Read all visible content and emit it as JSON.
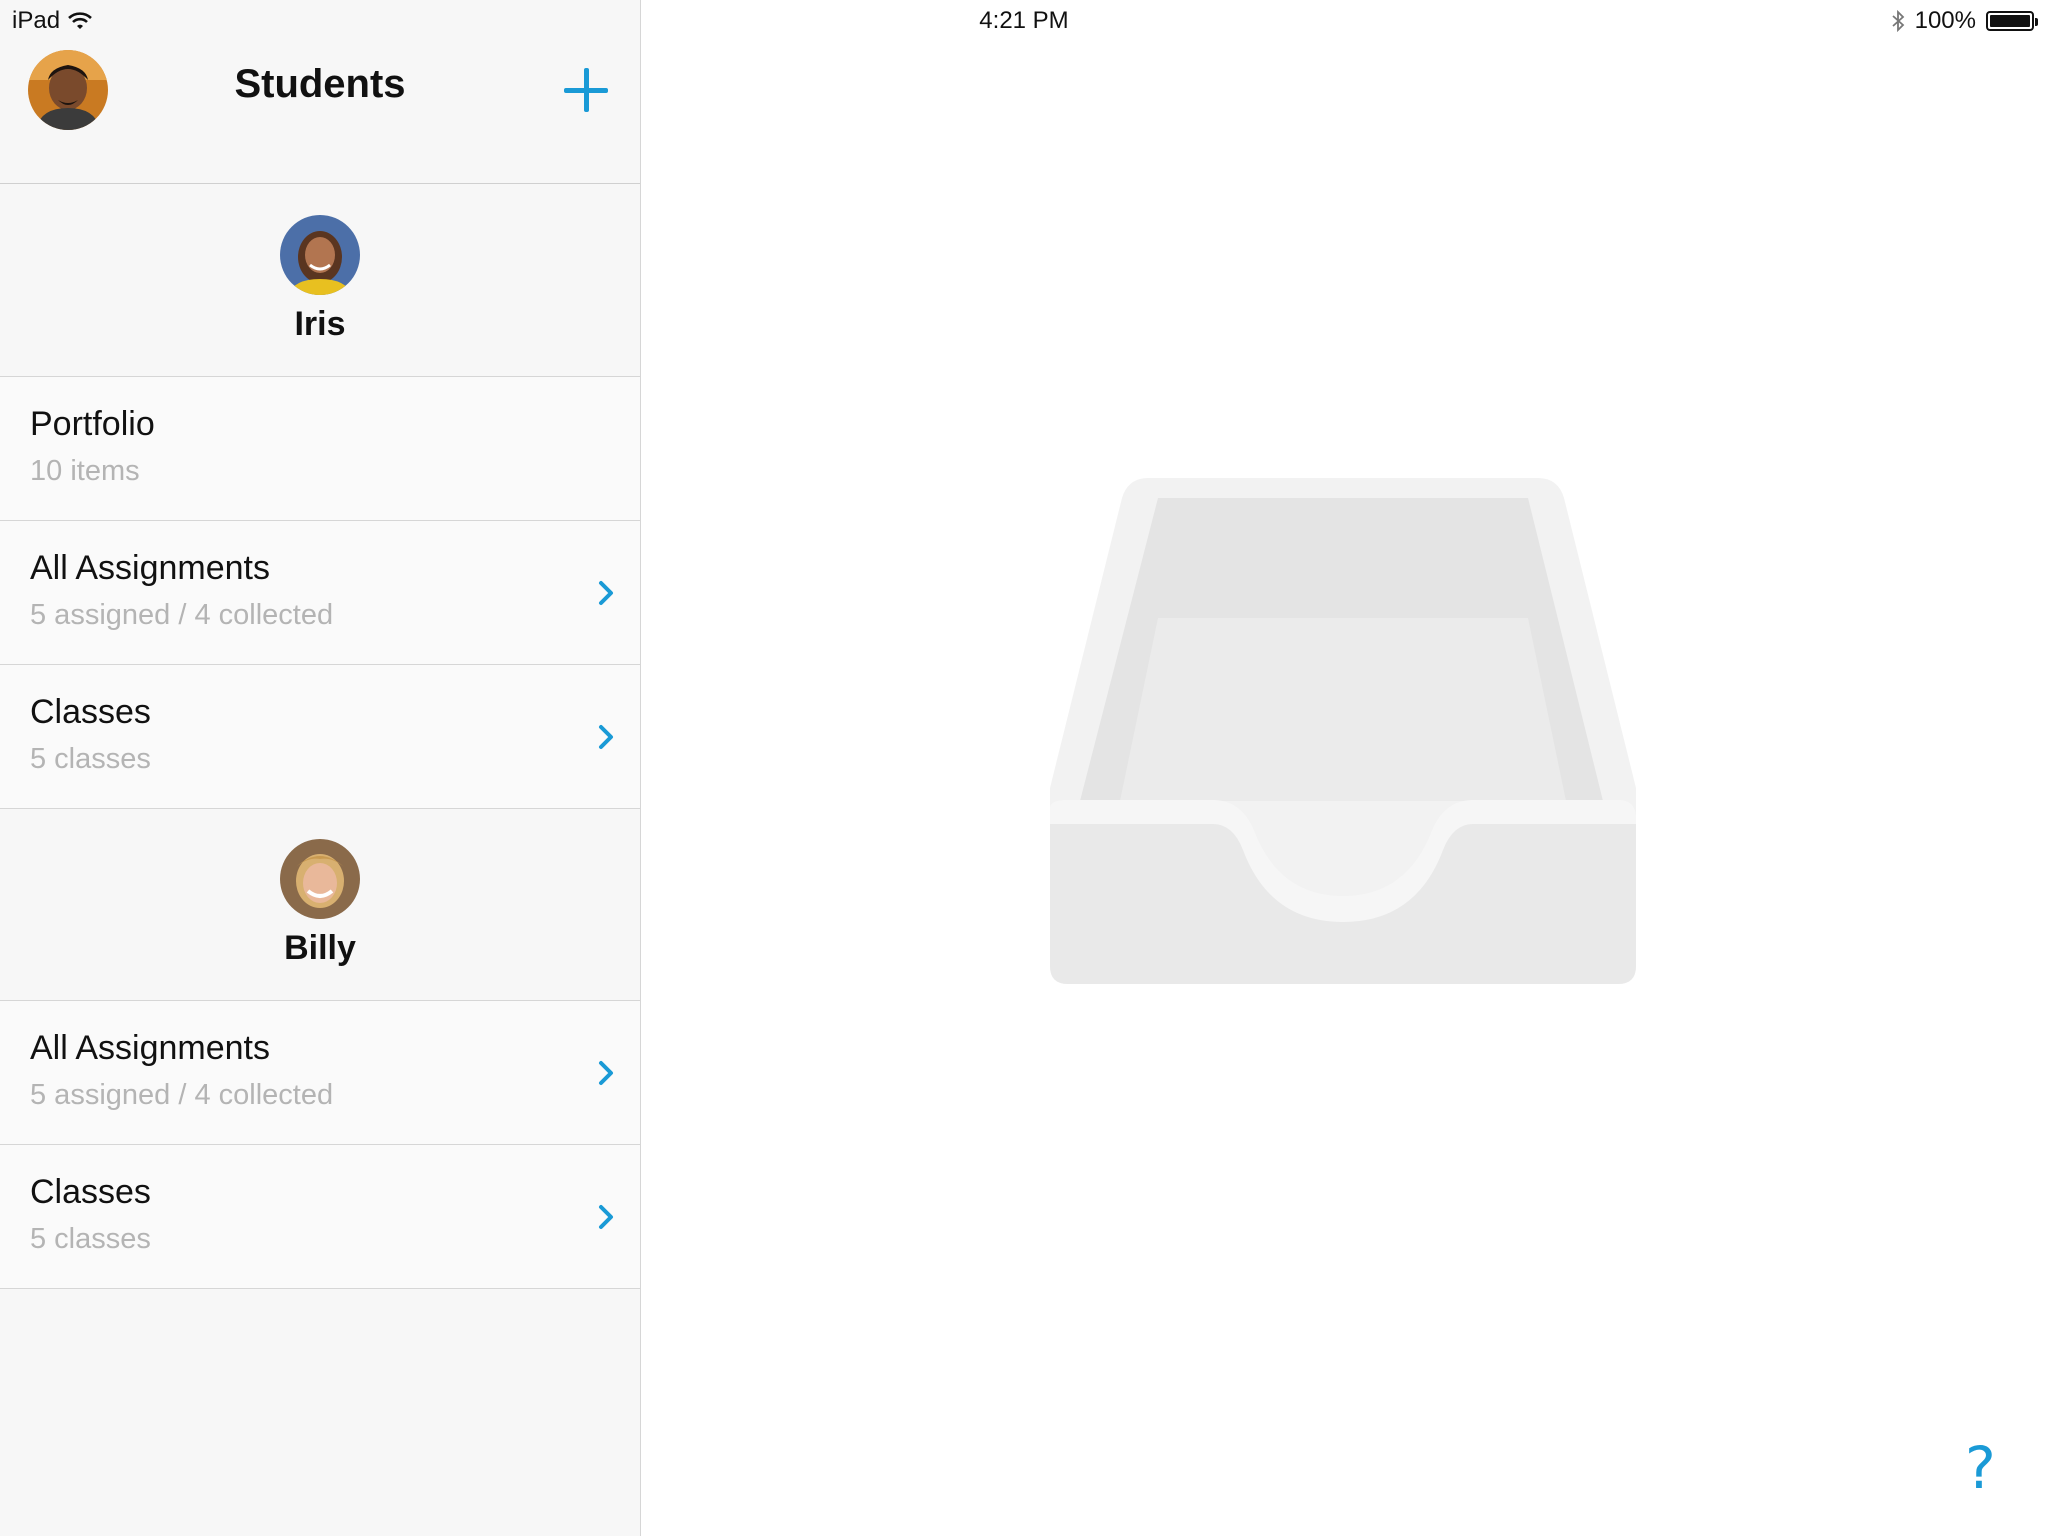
{
  "status_bar": {
    "device": "iPad",
    "time": "4:21 PM",
    "battery": "100%",
    "battery_level": 1.0
  },
  "header": {
    "title": "Students"
  },
  "students": [
    {
      "name": "Iris",
      "rows": [
        {
          "title": "Portfolio",
          "subtitle": "10 items"
        },
        {
          "title": "All Assignments",
          "subtitle": "5 assigned / 4 collected"
        },
        {
          "title": "Classes",
          "subtitle": "5 classes"
        }
      ]
    },
    {
      "name": "Billy",
      "rows": [
        {
          "title": "All Assignments",
          "subtitle": "5 assigned / 4 collected"
        },
        {
          "title": "Classes",
          "subtitle": "5 classes"
        }
      ]
    }
  ],
  "help": {
    "label": "?"
  },
  "colors": {
    "accent": "#1a9ad6",
    "subtitle": "#b4b4b4",
    "sidebar_bg": "#f7f7f7"
  }
}
